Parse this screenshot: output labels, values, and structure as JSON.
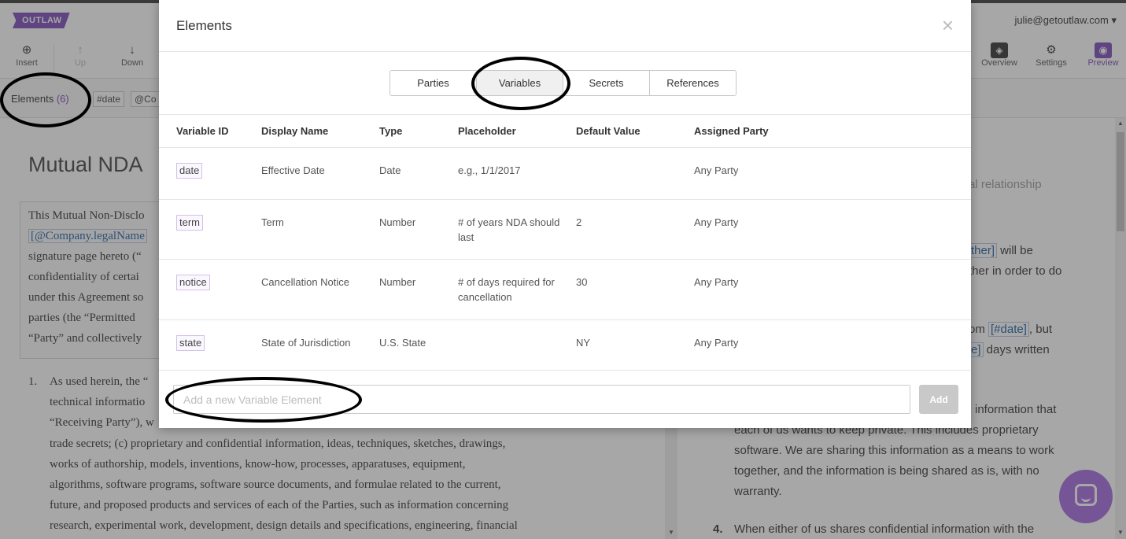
{
  "app": {
    "logo": "OUTLAW",
    "user_menu": "julie@getoutlaw.com ▾",
    "toolbar": {
      "insert": "Insert",
      "up": "Up",
      "down": "Down",
      "overview": "Overview",
      "settings": "Settings",
      "preview": "Preview"
    },
    "elements_label": "Elements",
    "elements_count": "(6)",
    "chips": [
      "#date",
      "@Co"
    ],
    "doc": {
      "title": "Mutual NDA",
      "para_line1": "This Mutual Non-Disclo",
      "para_var": "[@Company.legalName",
      "para_line3": "signature page hereto (“",
      "para_line4": "confidentiality of certai",
      "para_line5": "under this Agreement so",
      "para_line6": "parties (the “Permitted",
      "para_line7": "“Party” and collectively",
      "list_num": "1.",
      "list_line1": "As used herein, the “",
      "list_line2": "technical informatio",
      "list_line3": "“Receiving Party”), w",
      "list_line4": "trade secrets; (c) proprietary and confidential information, ideas, techniques, sketches, drawings,",
      "list_line5": "works of authorship, models, inventions, know-how, processes, apparatuses, equipment,",
      "list_line6": "algorithms, software programs, software source documents, and formulae related to the current,",
      "list_line7": "future, and proposed products and services of each of the Parties, such as information concerning",
      "list_line8": "research, experimental work, development, design details and specifications, engineering, financial"
    },
    "preview": {
      "l1": "al relationship",
      "l2_var": "ther]",
      "l2_rest": " will be",
      "l3": "ther in order to do",
      "l4_pre": "om ",
      "l4_var": "[#date]",
      "l4_rest": ", but",
      "l5_var": "e]",
      "l5_rest": " days written",
      "l6": "information that",
      "l7": "each of us wants to keep private. This includes proprietary",
      "l8": "software. We are sharing this information as a means to work",
      "l9": "together, and the information is being shared as is, with no",
      "l10": "warranty.",
      "l11_num": "4.",
      "l11": "When either of us shares confidential information with the"
    }
  },
  "modal": {
    "title": "Elements",
    "close": "×",
    "tabs": [
      {
        "label": "Parties",
        "active": false
      },
      {
        "label": "Variables",
        "active": true
      },
      {
        "label": "Secrets",
        "active": false
      },
      {
        "label": "References",
        "active": false
      }
    ],
    "columns": [
      "Variable ID",
      "Display Name",
      "Type",
      "Placeholder",
      "Default Value",
      "Assigned Party"
    ],
    "rows": [
      {
        "id": "date",
        "display": "Effective Date",
        "type": "Date",
        "placeholder": "e.g., 1/1/2017",
        "default": "",
        "party": "Any Party"
      },
      {
        "id": "term",
        "display": "Term",
        "type": "Number",
        "placeholder": "# of years NDA should last",
        "default": "2",
        "party": "Any Party"
      },
      {
        "id": "notice",
        "display": "Cancellation Notice",
        "type": "Number",
        "placeholder": "# of days required for cancellation",
        "default": "30",
        "party": "Any Party"
      },
      {
        "id": "state",
        "display": "State of Jurisdiction",
        "type": "U.S. State",
        "placeholder": "",
        "default": "NY",
        "party": "Any Party"
      }
    ],
    "add_placeholder": "Add a new Variable Element",
    "add_value": "",
    "add_button": "Add"
  },
  "colors": {
    "brand": "#7a4bb8",
    "chat": "#a66be0",
    "variable_chip_border": "#d5bfe9"
  }
}
